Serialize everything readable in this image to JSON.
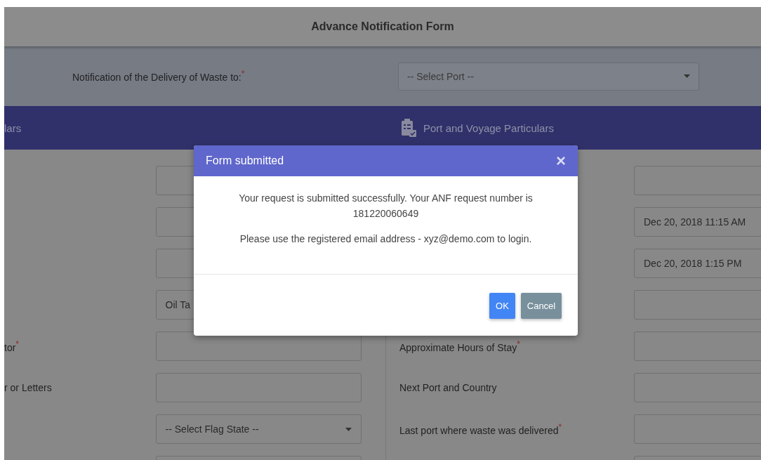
{
  "header": {
    "title": "Advance Notification Form"
  },
  "port_select": {
    "label": "Notification of the Delivery of Waste to:",
    "mark": "*",
    "placeholder": "-- Select Port --"
  },
  "sections": [
    {
      "label": "lars",
      "icon": false
    },
    {
      "label": "Port and Voyage Particulars",
      "icon": true
    }
  ],
  "left_rows": [
    {
      "kind": "text"
    },
    {
      "kind": "text"
    },
    {
      "kind": "text"
    },
    {
      "kind": "text",
      "value": "Oil Ta"
    },
    {
      "kind": "text",
      "label": "tor",
      "mark": "*"
    },
    {
      "kind": "text",
      "label": "r or Letters"
    },
    {
      "kind": "select",
      "placeholder": "-- Select Flag State --"
    },
    {
      "kind": "text"
    }
  ],
  "right_rows": [
    {
      "kind": "text"
    },
    {
      "kind": "text",
      "value": "Dec 20, 2018 11:15 AM"
    },
    {
      "kind": "text",
      "value": "Dec 20, 2018 1:15 PM"
    },
    {
      "kind": "text"
    },
    {
      "kind": "text",
      "label": "Approximate Hours of Stay",
      "mark": "*"
    },
    {
      "kind": "text",
      "label": "Next Port and Country"
    },
    {
      "kind": "text",
      "label": "Last port where waste was delivered",
      "mark": "*"
    },
    {
      "kind": "text"
    }
  ],
  "modal": {
    "title": "Form submitted",
    "close": "×",
    "paragraphs": [
      "Your request is submitted successfully. Your ANF request number is 181220060649",
      "Please use the registered email address - xyz@demo.com to login."
    ],
    "buttons": [
      {
        "label": "OK",
        "kind": "primary"
      },
      {
        "label": "Cancel",
        "kind": "secondary"
      }
    ]
  }
}
